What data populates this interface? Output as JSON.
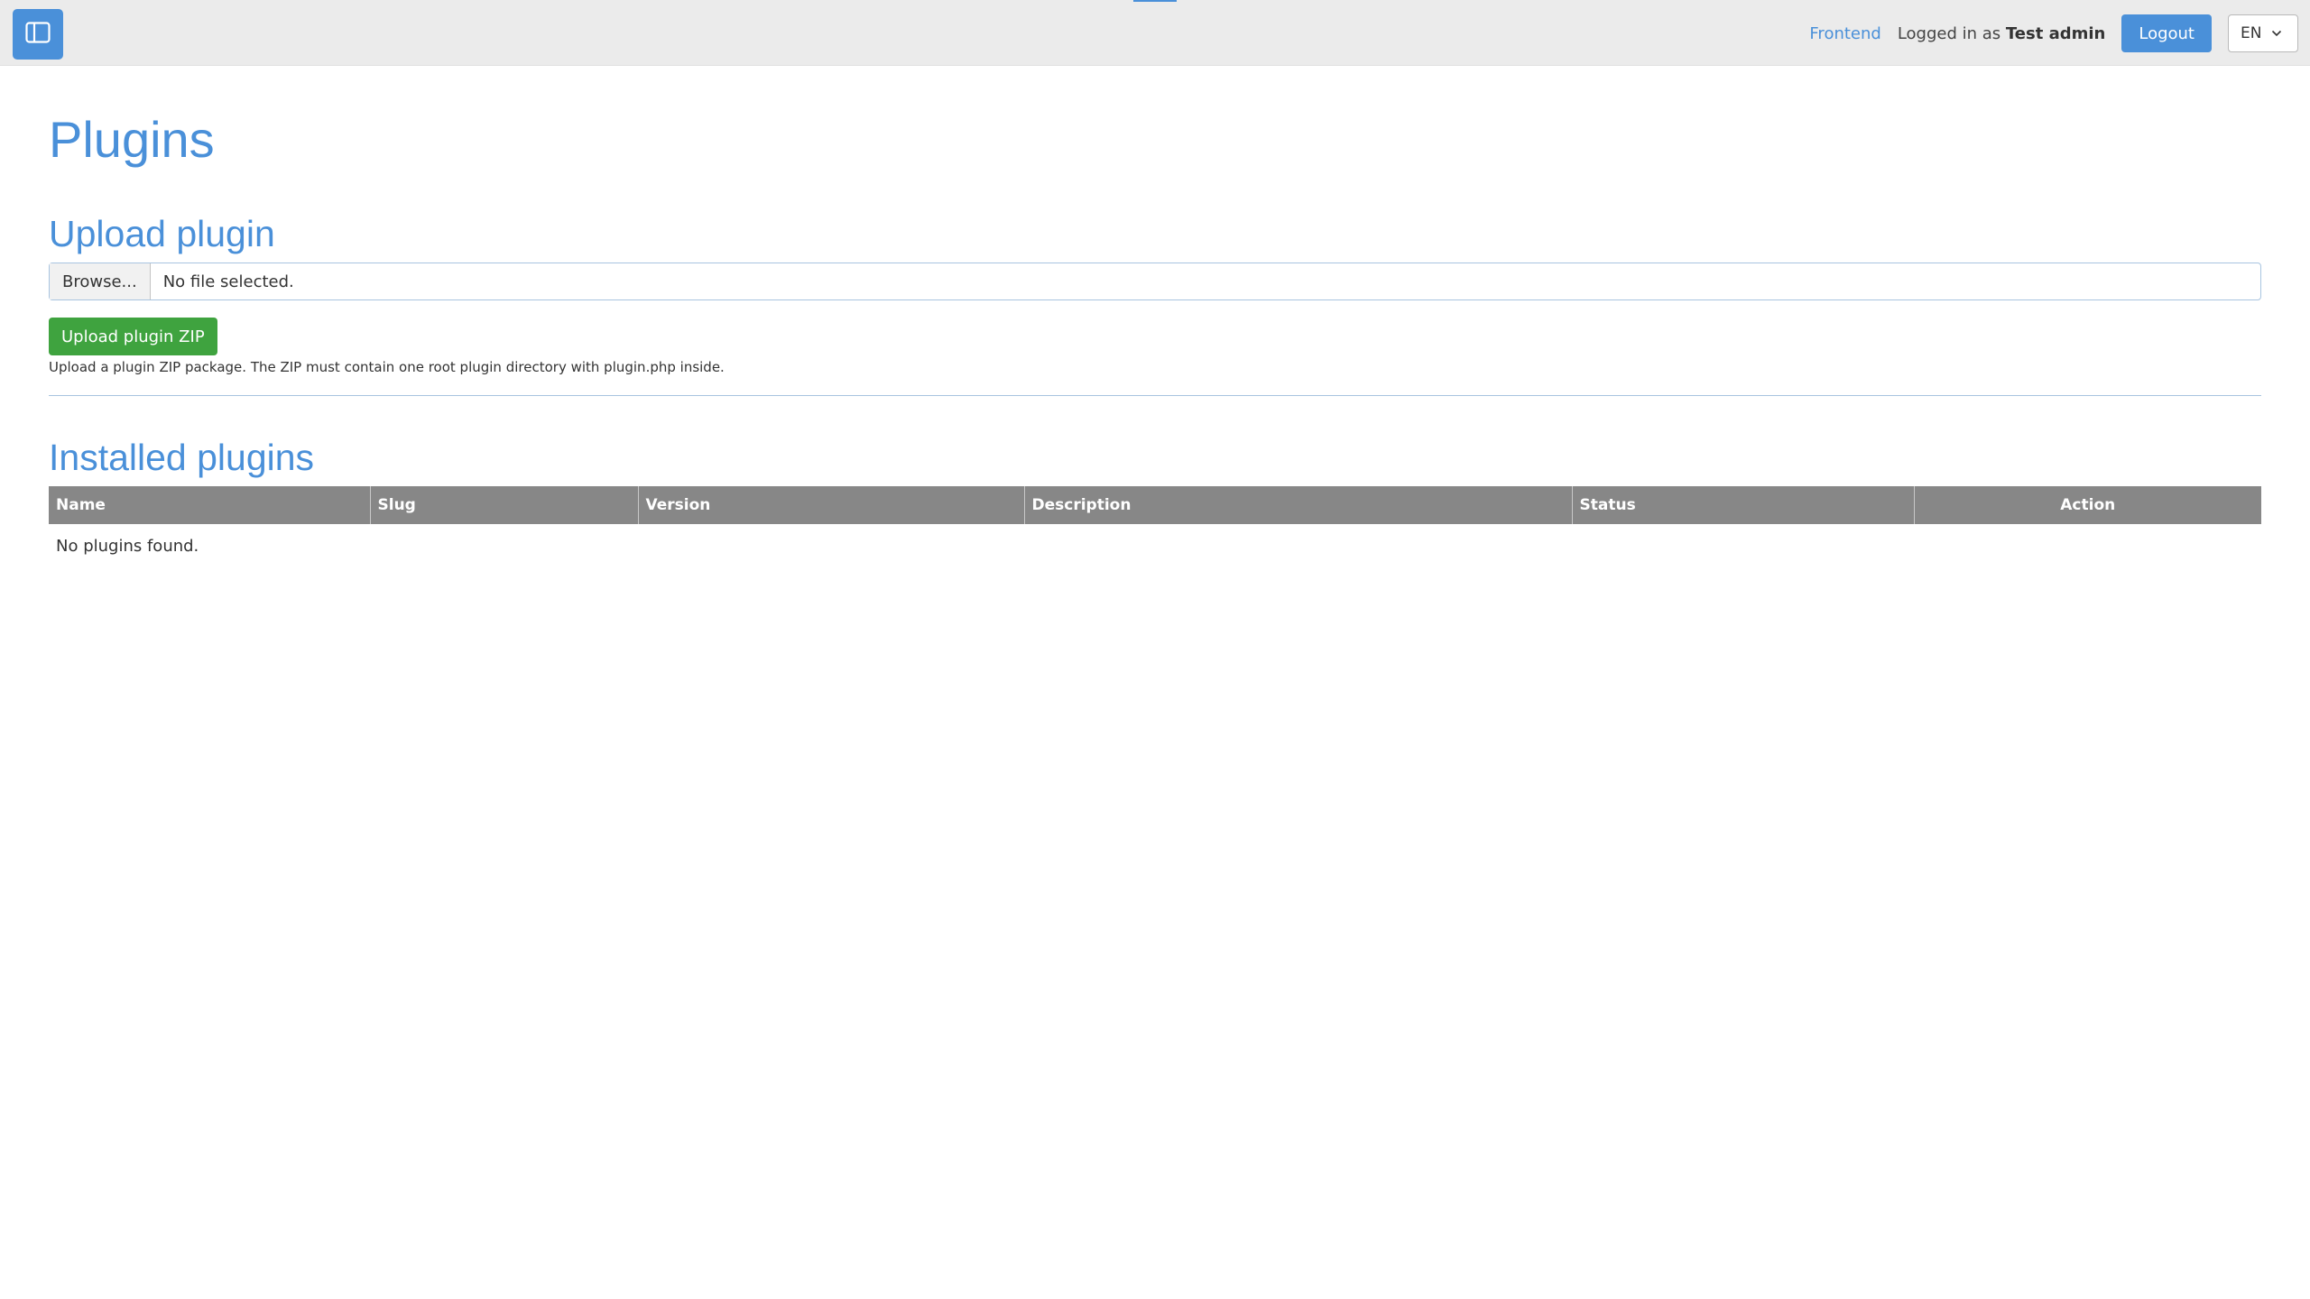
{
  "header": {
    "frontend_link": "Frontend",
    "logged_in_prefix": "Logged in as",
    "user_name": "Test admin",
    "logout_label": "Logout",
    "language": "EN"
  },
  "page": {
    "title": "Plugins"
  },
  "upload": {
    "title": "Upload plugin",
    "browse_label": "Browse...",
    "file_status": "No file selected.",
    "submit_label": "Upload plugin ZIP",
    "hint": "Upload a plugin ZIP package. The ZIP must contain one root plugin directory with plugin.php inside."
  },
  "installed": {
    "title": "Installed plugins",
    "columns": [
      "Name",
      "Slug",
      "Version",
      "Description",
      "Status",
      "Action"
    ],
    "empty_message": "No plugins found."
  },
  "colors": {
    "accent": "#4a90d9",
    "success": "#3fa33f",
    "table_header": "#878787",
    "topbar": "#ebebeb"
  },
  "icons": {
    "sidebar_toggle": "sidebar-toggle-icon",
    "language_dropdown": "chevron-down-icon"
  }
}
